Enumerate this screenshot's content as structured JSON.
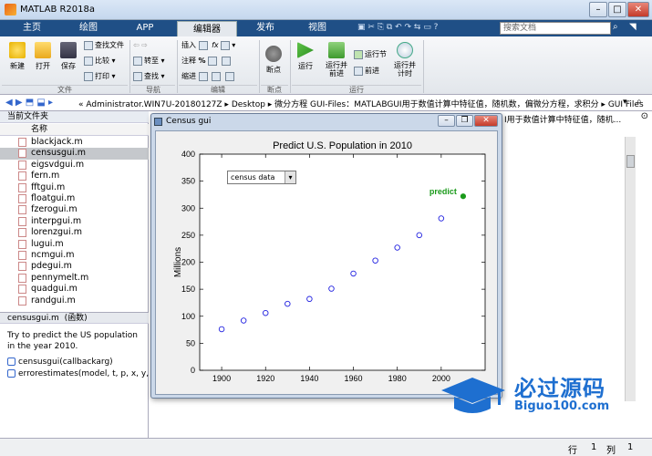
{
  "window": {
    "title": "MATLAB R2018a"
  },
  "tabs": [
    "主页",
    "绘图",
    "APP",
    "编辑器",
    "发布",
    "视图"
  ],
  "active_tab": "编辑器",
  "search": {
    "placeholder": "搜索文档"
  },
  "ribbon": {
    "new": "新建",
    "open": "打开",
    "save": "保存",
    "find_files": "查找文件",
    "compare": "比较",
    "print": "打印",
    "goto": "转至",
    "find": "查找",
    "insert": "插入",
    "comment": "注释",
    "indent": "缩进",
    "breakpoints": "断点",
    "run": "运行",
    "run_advance": "运行并\n前进",
    "run_section": "运行节",
    "advance": "前进",
    "run_time": "运行并\n计时",
    "groups": {
      "file": "文件",
      "navigate": "导航",
      "edit": "编辑",
      "breakpoints": "断点",
      "run": "运行"
    }
  },
  "address": {
    "path": "« Administrator.WIN7U-20180127Z  ▸  Desktop  ▸  微分方程 GUI-Files：MATLABGUI用于数值计算中特征值，随机数，偏微分方程，求积分  ▸  GUI Files"
  },
  "left_panel": {
    "header": "当前文件夹",
    "column": "名称",
    "files": [
      "blackjack.m",
      "censusgui.m",
      "eigsvdgui.m",
      "fern.m",
      "fftgui.m",
      "floatgui.m",
      "fzerogui.m",
      "interpgui.m",
      "lorenzgui.m",
      "lugui.m",
      "ncmgui.m",
      "pdegui.m",
      "pennymelt.m",
      "quadgui.m",
      "randgui.m"
    ],
    "selected": "censusgui.m",
    "detail_name": "censusgui.m",
    "detail_type": "(函数)",
    "help_text": "Try to predict the US population in the year 2010.",
    "functions": [
      "censusgui(callbackarg)",
      "errorestimates(model, t, p, x, y, d)"
    ]
  },
  "behind_text": "I用于数值计算中特征值，随机...",
  "figure": {
    "title": "Census gui",
    "dropdown": "census data",
    "predict_label": "predict"
  },
  "chart_data": {
    "type": "scatter",
    "title": "Predict U.S. Population in 2010",
    "xlabel": "",
    "ylabel": "Millions",
    "xlim": [
      1890,
      2020
    ],
    "ylim": [
      0,
      400
    ],
    "xticks": [
      1900,
      1920,
      1940,
      1960,
      1980,
      2000
    ],
    "yticks": [
      0,
      50,
      100,
      150,
      200,
      250,
      300,
      350,
      400
    ],
    "series": [
      {
        "x": [
          1900,
          1910,
          1920,
          1930,
          1940,
          1950,
          1960,
          1970,
          1980,
          1990,
          2000
        ],
        "values": [
          76,
          92,
          106,
          123,
          132,
          151,
          179,
          203,
          227,
          250,
          281
        ],
        "color": "#2020e0"
      },
      {
        "x": [
          2010
        ],
        "values": [
          322
        ],
        "color": "#1a9a1a"
      }
    ]
  },
  "watermark": {
    "brand": "必过源码",
    "url": "Biguo100.com"
  },
  "status": {
    "row_label": "行",
    "row": "1",
    "col_label": "列",
    "col": "1"
  }
}
